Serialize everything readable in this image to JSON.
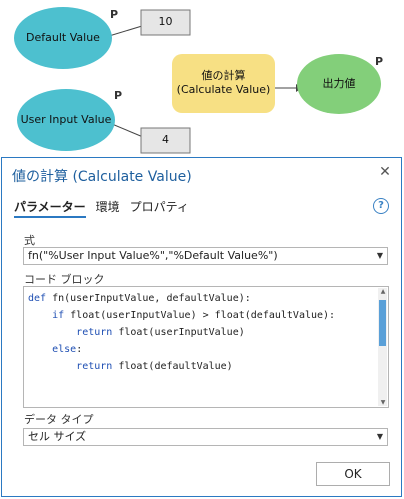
{
  "diagram": {
    "nodes": {
      "default_value": "Default Value",
      "user_input_value": "User Input Value",
      "calculate_value": "値の計算\n(Calculate Value)",
      "output_value": "出力値",
      "value_10": "10",
      "value_4": "4"
    },
    "p_marker": "P",
    "colors": {
      "variable_fill": "#4dc0cf",
      "tool_fill": "#f7e084",
      "output_fill": "#83cf7a"
    }
  },
  "dialog": {
    "title": "値の計算 (Calculate Value)",
    "close_icon": "✕",
    "tabs": [
      {
        "label": "パラメーター",
        "active": true
      },
      {
        "label": "環境",
        "active": false
      },
      {
        "label": "プロパティ",
        "active": false
      }
    ],
    "help_icon": "?",
    "expression": {
      "label": "式",
      "value": "fn(\"%User Input Value%\",\"%Default Value%\")"
    },
    "code_block": {
      "label": "コード ブロック",
      "lines": [
        "def fn(userInputValue, defaultValue):",
        "    if float(userInputValue) > float(defaultValue):",
        "        return float(userInputValue)",
        "    else:",
        "        return float(defaultValue)"
      ]
    },
    "data_type": {
      "label": "データ タイプ",
      "value": "セル サイズ"
    },
    "ok_label": "OK"
  }
}
